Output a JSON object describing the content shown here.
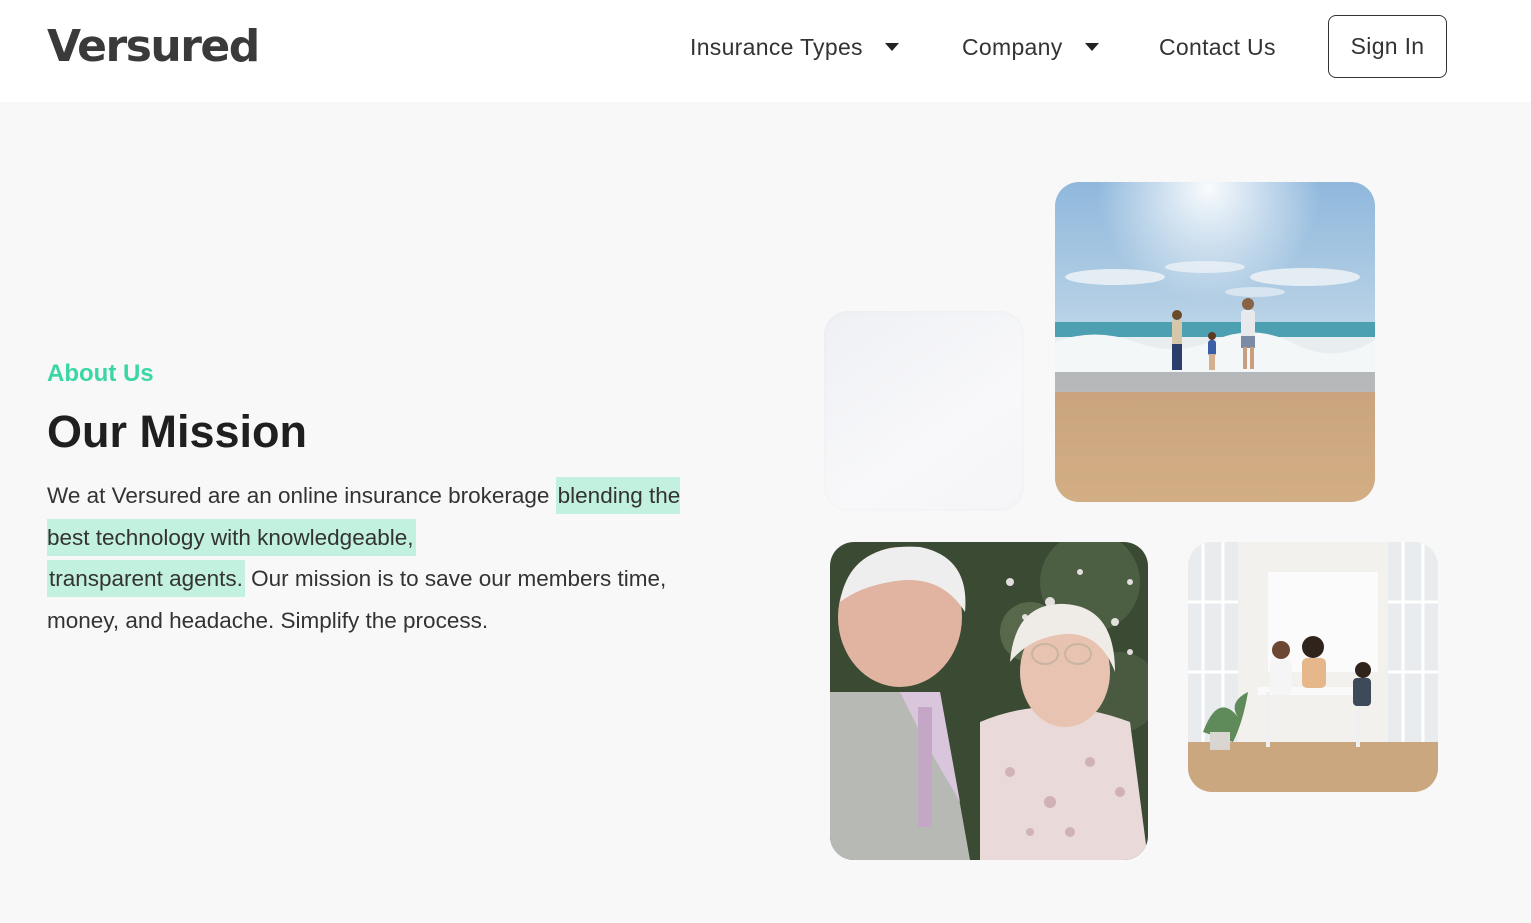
{
  "header": {
    "logo": "Versured",
    "nav": [
      {
        "label": "Insurance Types",
        "has_dropdown": true
      },
      {
        "label": "Company",
        "has_dropdown": true
      },
      {
        "label": "Contact Us",
        "has_dropdown": false
      }
    ],
    "sign_in_label": "Sign In"
  },
  "hero": {
    "eyebrow": "About Us",
    "title": "Our Mission",
    "paragraph_start": "We at Versured are an online insurance brokerage ",
    "paragraph_highlight_1": "blending the best technology with knowledgeable,",
    "paragraph_highlight_2": "transparent agents.",
    "paragraph_end": " Our mission is to save our members time, money, and headache. Simplify the process."
  },
  "images": {
    "beach_photo": "family-at-beach-photo",
    "couple_photo": "senior-couple-photo",
    "family_photo": "family-dining-photo"
  },
  "colors": {
    "accent": "#3ad6a5",
    "highlight": "#c3f1df",
    "text": "#333333",
    "background": "#f8f8f8"
  }
}
